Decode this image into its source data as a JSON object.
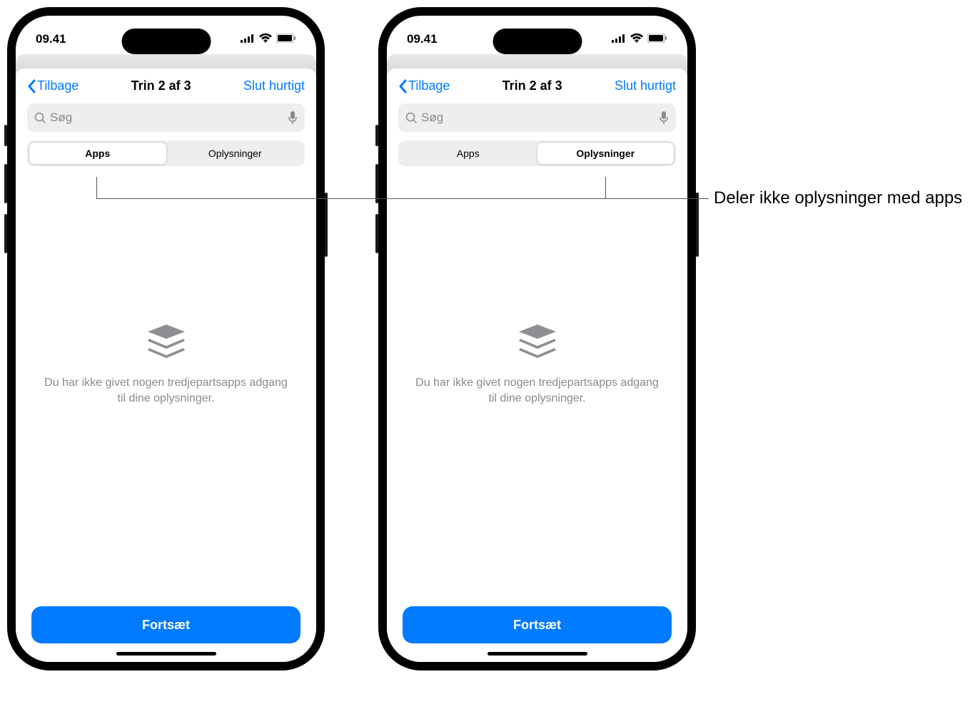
{
  "status": {
    "time": "09.41"
  },
  "nav": {
    "back": "Tilbage",
    "title": "Trin 2 af 3",
    "action": "Slut hurtigt"
  },
  "search": {
    "placeholder": "Søg"
  },
  "segments": {
    "apps": "Apps",
    "info": "Oplysninger"
  },
  "empty": {
    "message": "Du har ikke givet nogen tredjepartsapps adgang til dine oplysninger."
  },
  "continue": "Fortsæt",
  "callout": {
    "text": "Deler ikke oplysninger med apps"
  }
}
